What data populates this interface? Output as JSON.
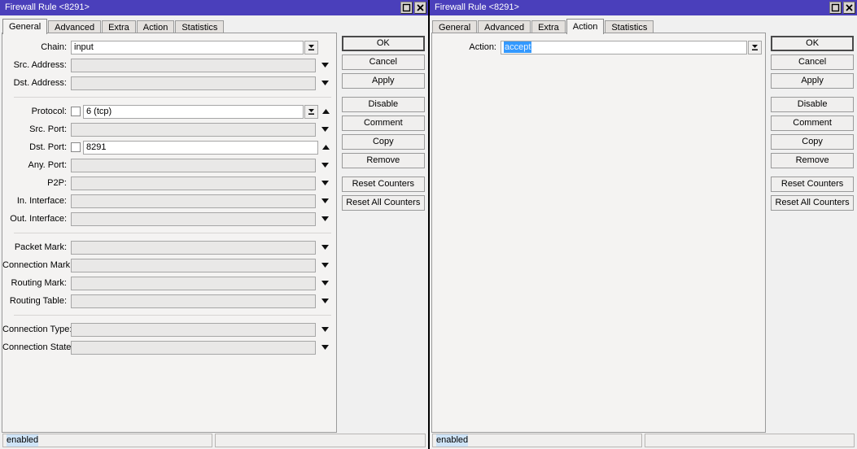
{
  "windows": [
    {
      "title": "Firewall Rule <8291>",
      "controls": {
        "maximize": "maximize-icon",
        "close": "close-icon"
      },
      "tabs": [
        {
          "label": "General",
          "active": true
        },
        {
          "label": "Advanced",
          "active": false
        },
        {
          "label": "Extra",
          "active": false
        },
        {
          "label": "Action",
          "active": false
        },
        {
          "label": "Statistics",
          "active": false
        }
      ],
      "fields": [
        {
          "label": "Chain:",
          "value": "input",
          "enabled": true,
          "checkbox": false,
          "control": "dropdown-button",
          "spinner": false
        },
        {
          "label": "Src. Address:",
          "value": "",
          "enabled": false,
          "checkbox": false,
          "control": "dropdown-plain",
          "spinner": false
        },
        {
          "label": "Dst. Address:",
          "value": "",
          "enabled": false,
          "checkbox": false,
          "control": "dropdown-plain",
          "spinner": false
        },
        {
          "separator": true
        },
        {
          "label": "Protocol:",
          "value": "6 (tcp)",
          "enabled": true,
          "checkbox": true,
          "control": "dropdown-button",
          "spinner": "up"
        },
        {
          "label": "Src. Port:",
          "value": "",
          "enabled": false,
          "checkbox": false,
          "control": "dropdown-plain",
          "spinner": false
        },
        {
          "label": "Dst. Port:",
          "value": "8291",
          "enabled": true,
          "checkbox": true,
          "control": "none",
          "spinner": "up"
        },
        {
          "label": "Any. Port:",
          "value": "",
          "enabled": false,
          "checkbox": false,
          "control": "dropdown-plain",
          "spinner": false
        },
        {
          "label": "P2P:",
          "value": "",
          "enabled": false,
          "checkbox": false,
          "control": "dropdown-plain",
          "spinner": false
        },
        {
          "label": "In. Interface:",
          "value": "",
          "enabled": false,
          "checkbox": false,
          "control": "dropdown-plain",
          "spinner": false
        },
        {
          "label": "Out. Interface:",
          "value": "",
          "enabled": false,
          "checkbox": false,
          "control": "dropdown-plain",
          "spinner": false
        },
        {
          "separator": true
        },
        {
          "label": "Packet Mark:",
          "value": "",
          "enabled": false,
          "checkbox": false,
          "control": "dropdown-plain",
          "spinner": false
        },
        {
          "label": "Connection Mark:",
          "value": "",
          "enabled": false,
          "checkbox": false,
          "control": "dropdown-plain",
          "spinner": false
        },
        {
          "label": "Routing Mark:",
          "value": "",
          "enabled": false,
          "checkbox": false,
          "control": "dropdown-plain",
          "spinner": false
        },
        {
          "label": "Routing Table:",
          "value": "",
          "enabled": false,
          "checkbox": false,
          "control": "dropdown-plain",
          "spinner": false
        },
        {
          "separator": true
        },
        {
          "label": "Connection Type:",
          "value": "",
          "enabled": false,
          "checkbox": false,
          "control": "dropdown-plain",
          "spinner": false
        },
        {
          "label": "Connection State:",
          "value": "",
          "enabled": false,
          "checkbox": false,
          "control": "dropdown-plain",
          "spinner": false
        }
      ],
      "buttons": [
        {
          "label": "OK",
          "focused": true,
          "gap": false
        },
        {
          "label": "Cancel",
          "focused": false,
          "gap": false
        },
        {
          "label": "Apply",
          "focused": false,
          "gap": false
        },
        {
          "label": "Disable",
          "focused": false,
          "gap": true
        },
        {
          "label": "Comment",
          "focused": false,
          "gap": false
        },
        {
          "label": "Copy",
          "focused": false,
          "gap": false
        },
        {
          "label": "Remove",
          "focused": false,
          "gap": false
        },
        {
          "label": "Reset Counters",
          "focused": false,
          "gap": true
        },
        {
          "label": "Reset All Counters",
          "focused": false,
          "gap": false
        }
      ],
      "status": {
        "text": "enabled",
        "second": ""
      }
    },
    {
      "title": "Firewall Rule <8291>",
      "controls": {
        "maximize": "maximize-icon",
        "close": "close-icon"
      },
      "tabs": [
        {
          "label": "General",
          "active": false
        },
        {
          "label": "Advanced",
          "active": false
        },
        {
          "label": "Extra",
          "active": false
        },
        {
          "label": "Action",
          "active": true
        },
        {
          "label": "Statistics",
          "active": false
        }
      ],
      "fields": [
        {
          "label": "Action:",
          "value": "accept",
          "enabled": true,
          "checkbox": false,
          "control": "dropdown-button",
          "spinner": false,
          "selected": true
        }
      ],
      "buttons": [
        {
          "label": "OK",
          "focused": true,
          "gap": false
        },
        {
          "label": "Cancel",
          "focused": false,
          "gap": false
        },
        {
          "label": "Apply",
          "focused": false,
          "gap": false
        },
        {
          "label": "Disable",
          "focused": false,
          "gap": true
        },
        {
          "label": "Comment",
          "focused": false,
          "gap": false
        },
        {
          "label": "Copy",
          "focused": false,
          "gap": false
        },
        {
          "label": "Remove",
          "focused": false,
          "gap": false
        },
        {
          "label": "Reset Counters",
          "focused": false,
          "gap": true
        },
        {
          "label": "Reset All Counters",
          "focused": false,
          "gap": false
        }
      ],
      "status": {
        "text": "enabled",
        "second": ""
      }
    }
  ],
  "colors": {
    "titlebar": "#4a3fbb",
    "selection": "#3399ff",
    "panel": "#f4f3f2",
    "window": "#f0f0f0",
    "disabled_field": "#e9e8e7"
  }
}
